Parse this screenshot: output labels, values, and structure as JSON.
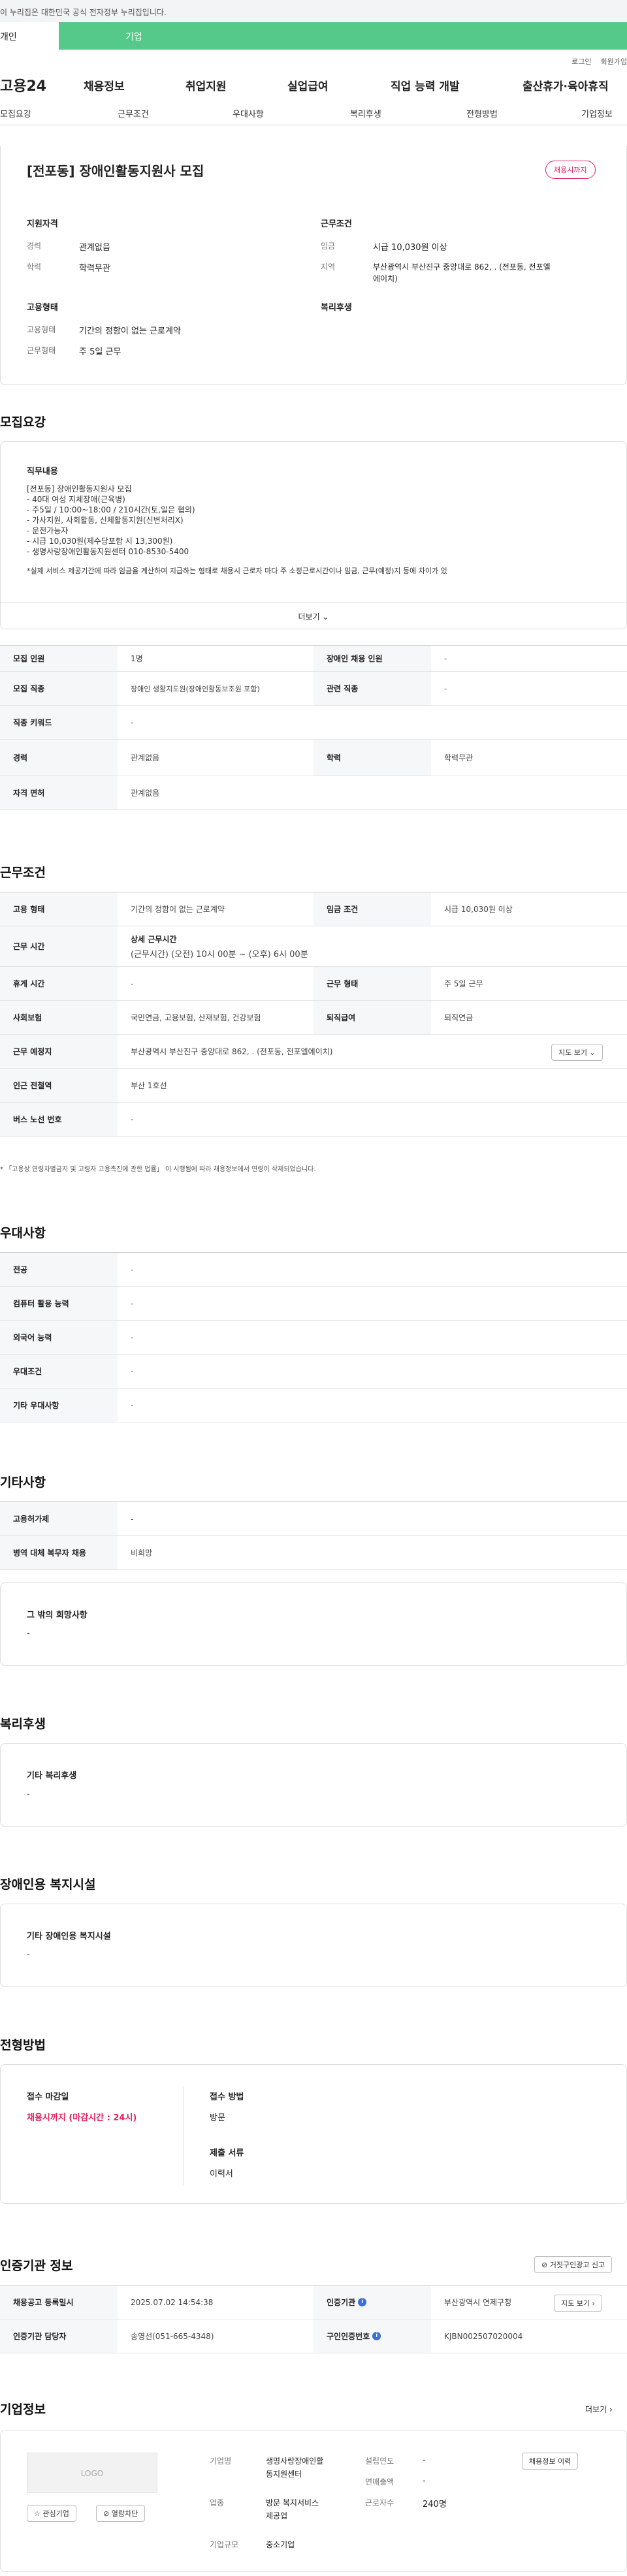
{
  "gov_banner": "이 누리집은 대한민국 공식 전자정부 누리집입니다.",
  "user_tabs": [
    "개인",
    "기업"
  ],
  "top_links": [
    "로그인",
    "회원가입"
  ],
  "logo": "고용24",
  "gnb": [
    "채용정보",
    "취업지원",
    "실업급여",
    "직업 능력 개발",
    "출산휴가·육아휴직"
  ],
  "section_tabs": [
    "모집요강",
    "근무조건",
    "우대사항",
    "복리후생",
    "전형방법",
    "기업정보"
  ],
  "job": {
    "title": "[전포동] 장애인활동지원사 모집",
    "badge": "채용시까지",
    "qual_h": "지원자격",
    "career_l": "경력",
    "career_v": "관계없음",
    "edu_l": "학력",
    "edu_v": "학력무관",
    "cond_h": "근무조건",
    "wage_l": "임금",
    "wage_v": "시급 10,030원 이상",
    "region_l": "지역",
    "region_v1": "부산광역시 부산진구 중앙대로 862, . (전포동, 전포엘",
    "region_v2": "에이치)",
    "emp_h": "고용형태",
    "etype_l": "고용형태",
    "etype_v": "기간의 정함이 없는 근로계약",
    "eform_l": "근무형태",
    "eform_v": "주 5일 근무",
    "welfare_h": "복리후생"
  },
  "recruit": {
    "h": "모집요강",
    "duty_h": "직무내용",
    "lines": [
      "[전포동] 장애인활동지원사 모집",
      "- 40대 여성 지체장애(근육병)",
      "- 주5일 / 10:00~18:00 / 210시간(토,일은 협의)",
      "- 가사지원, 사회활동, 신체활동지원(신변처리X)",
      "- 운전가능자",
      "- 시급 10,030원(제수당포함 시 13,300원)",
      "- 생명사랑장애인활동지원센터 010-8530-5400",
      "",
      "*실제 서비스 제공기간에 따라 임금을 계산하여 지급하는 형태로 채용시 근로자 마다 주 소정근로시간이나 임금, 근무(예정)지 등에 차이가 있"
    ],
    "more": "더보기",
    "table": [
      [
        "모집 인원",
        "1명",
        "장애인 채용 인원",
        "-"
      ],
      [
        "모집 직종",
        "장애인 생활지도원(장애인활동보조원 포함)",
        "관련 직종",
        "-"
      ],
      [
        "직종 키워드",
        "-",
        "",
        ""
      ],
      [
        "경력",
        "관계없음",
        "학력",
        "학력무관"
      ],
      [
        "자격 면허",
        "관계없음",
        "",
        ""
      ]
    ]
  },
  "workcond": {
    "h": "근무조건",
    "r1": [
      "고용 형태",
      "기간의 정함이 없는 근로계약",
      "임금 조건",
      "시급 10,030원 이상"
    ],
    "r2_th": "근무 시간",
    "r2_sub": "상세 근무시간",
    "r2_v": "(근무시간) (오전) 10시 00분 ~ (오후) 6시 00분",
    "r3": [
      "휴게 시간",
      "-",
      "근무 형태",
      "주 5일 근무"
    ],
    "r4": [
      "사회보험",
      "국민연금, 고용보험, 산재보험, 건강보험",
      "퇴직급여",
      "퇴직연금"
    ],
    "r5": [
      "근무 예정지",
      "부산광역시 부산진구 중앙대로 862, . (전포동, 전포엘에이치)"
    ],
    "map": "지도 보기",
    "r6": [
      "인근 전철역",
      "부산 1호선"
    ],
    "r7": [
      "버스 노선 번호",
      "-"
    ],
    "note": "* 「고용상 연령차별금지 및 고령자 고용촉진에 관한 법률」 이 시행됨에 따라 채용정보에서 연령이 삭제되었습니다."
  },
  "pref": {
    "h": "우대사항",
    "rows": [
      [
        "전공",
        "-"
      ],
      [
        "컴퓨터 활용 능력",
        "-"
      ],
      [
        "외국어 능력",
        "-"
      ],
      [
        "우대조건",
        "-"
      ],
      [
        "기타 우대사항",
        "-"
      ]
    ]
  },
  "etc": {
    "h": "기타사항",
    "rows": [
      [
        "고용허가제",
        "-"
      ],
      [
        "병역 대체 복무자 채용",
        "비희망"
      ]
    ],
    "wish_h": "그 밖의 희망사항",
    "wish_v": "-"
  },
  "welfare": {
    "h": "복리후생",
    "sub": "기타 복리후생",
    "v": "-"
  },
  "disab": {
    "h": "장애인용 복지시설",
    "sub": "기타 장애인용 복지시설",
    "v": "-"
  },
  "screen": {
    "h": "전형방법",
    "deadline_l": "접수 마감일",
    "deadline_v": "채용시까지 (마감시간 : 24시)",
    "method_l": "접수 방법",
    "method_v": "방문",
    "docs_l": "제출 서류",
    "docs_v": "이력서"
  },
  "agency": {
    "h": "인증기관 정보",
    "report": "거짓구인광고 신고",
    "r1": [
      "채용공고 등록일시",
      "2025.07.02 14:54:38",
      "인증기관",
      "부산광역시 연제구청"
    ],
    "r2": [
      "인증기관 담당자",
      "송영선(051-665-4348)",
      "구인인증번호",
      "KJBN002507020004"
    ],
    "map": "지도 보기"
  },
  "company": {
    "h": "기업정보",
    "more": "더보기",
    "logo": "LOGO",
    "fav": "관심기업",
    "block": "열람차단",
    "history": "채용정보 이력",
    "name_l": "기업명",
    "name_v1": "생명사랑장애인활",
    "name_v2": "동지원센터",
    "ind_l": "업종",
    "ind_v1": "방문 복지서비스",
    "ind_v2": "제공업",
    "size_l": "기업규모",
    "size_v": "중소기업",
    "year_l": "설립연도",
    "year_v": "-",
    "sales_l": "연매출액",
    "sales_v": "-",
    "emp_l": "근로자수",
    "emp_v": "240명"
  },
  "colors": {
    "green": "#55c98a",
    "red": "#e2245f",
    "blue": "#3b6fd4"
  }
}
